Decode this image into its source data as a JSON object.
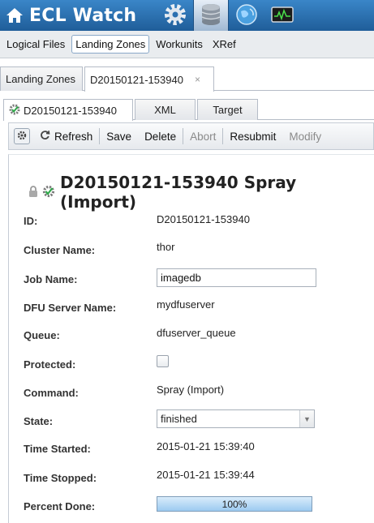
{
  "app": {
    "title": "ECL Watch"
  },
  "top_icons": [
    "gear-icon",
    "database-icon",
    "globe-icon",
    "monitor-icon"
  ],
  "main_nav": [
    "Logical Files",
    "Landing Zones",
    "Workunits",
    "XRef"
  ],
  "outer_tabs": {
    "landing_zones": "Landing Zones",
    "workunit": "D20150121-153940",
    "close": "×"
  },
  "inner_tabs": {
    "summary": "D20150121-153940",
    "xml": "XML",
    "target": "Target"
  },
  "toolbar": {
    "refresh": "Refresh",
    "save": "Save",
    "delete": "Delete",
    "abort": "Abort",
    "resubmit": "Resubmit",
    "modify": "Modify"
  },
  "details": {
    "heading": "D20150121-153940 Spray (Import)",
    "id_label": "ID:",
    "id_value": "D20150121-153940",
    "cluster_label": "Cluster Name:",
    "cluster_value": "thor",
    "job_label": "Job Name:",
    "job_value": "imagedb",
    "dfu_label": "DFU Server Name:",
    "dfu_value": "mydfuserver",
    "queue_label": "Queue:",
    "queue_value": "dfuserver_queue",
    "protected_label": "Protected:",
    "protected_checked": false,
    "command_label": "Command:",
    "command_value": "Spray (Import)",
    "state_label": "State:",
    "state_value": "finished",
    "started_label": "Time Started:",
    "started_value": "2015-01-21 15:39:40",
    "stopped_label": "Time Stopped:",
    "stopped_value": "2015-01-21 15:39:44",
    "percent_label": "Percent Done:",
    "percent_value": "100%",
    "percent_fraction": 1.0
  },
  "colors": {
    "banner": "#2a6fb0",
    "progress": "#9ccaf0"
  }
}
